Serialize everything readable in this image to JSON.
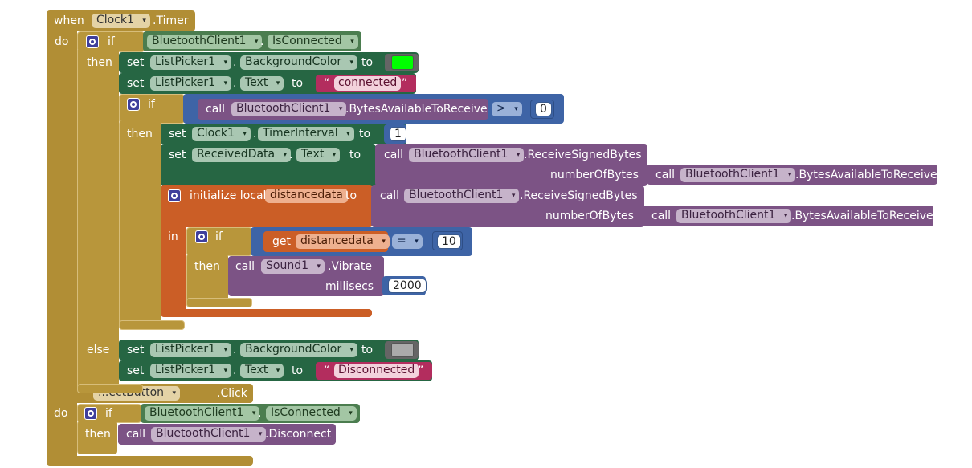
{
  "workspace": {
    "event1": {
      "when": "when",
      "component": "Clock1",
      "event": ".Timer",
      "do": "do",
      "if_label": "if",
      "then": "then",
      "else": "else",
      "cond_component": "BluetoothClient1",
      "cond_property": "IsConnected",
      "then_block": {
        "set1": {
          "set": "set",
          "component": "ListPicker1",
          "dot": ".",
          "property": "BackgroundColor",
          "to": "to",
          "color": "#00ff00"
        },
        "set2": {
          "set": "set",
          "component": "ListPicker1",
          "dot": ".",
          "property": "Text",
          "to": "to",
          "open_quote": "“",
          "value": "connected",
          "close_quote": "”"
        },
        "inner_if": {
          "if_label": "if",
          "call": "call",
          "component": "BluetoothClient1",
          "method": ".BytesAvailableToReceive",
          "operator": ">",
          "compare_value": "0",
          "then": "then",
          "set_interval": {
            "set": "set",
            "component": "Clock1",
            "dot": ".",
            "property": "TimerInterval",
            "to": "to",
            "value": "1"
          },
          "set_received": {
            "set": "set",
            "component": "ReceivedData",
            "dot": ".",
            "property": "Text",
            "to": "to",
            "call": "call",
            "call_component": "BluetoothClient1",
            "call_method": ".ReceiveSignedBytes",
            "param_label": "numberOfBytes",
            "param_call": "call",
            "param_component": "BluetoothClient1",
            "param_method": ".BytesAvailableToReceive"
          },
          "init_local": {
            "label": "initialize local",
            "var_name": "distancedata",
            "to": "to",
            "call": "call",
            "call_component": "BluetoothClient1",
            "call_method": ".ReceiveSignedBytes",
            "param_label": "numberOfBytes",
            "param_call": "call",
            "param_component": "BluetoothClient1",
            "param_method": ".BytesAvailableToReceive",
            "in": "in",
            "if_label": "if",
            "get": "get",
            "get_var": "distancedata",
            "operator": "=",
            "compare_value": "10",
            "then": "then",
            "vib_call": "call",
            "vib_component": "Sound1",
            "vib_method": ".Vibrate",
            "vib_param": "millisecs",
            "vib_value": "2000"
          }
        }
      },
      "else_block": {
        "set1": {
          "set": "set",
          "component": "ListPicker1",
          "dot": ".",
          "property": "BackgroundColor",
          "to": "to",
          "color": "#aaaaaa"
        },
        "set2": {
          "set": "set",
          "component": "ListPicker1",
          "dot": ".",
          "property": "Text",
          "to": "to",
          "open_quote": "“",
          "value": "Disconnected",
          "close_quote": "”"
        }
      }
    },
    "event2": {
      "component_partial": "...ectButton",
      "event": ".Click",
      "do": "do",
      "if_label": "if",
      "cond_component": "BluetoothClient1",
      "cond_property": "IsConnected",
      "then": "then",
      "call": "call",
      "call_component": "BluetoothClient1",
      "call_method": ".Disconnect"
    }
  },
  "dropdown_arrow": "▾",
  "colors": {
    "event": "#b18e35",
    "control": "#b8963b",
    "setter": "#266643",
    "bluetooth_getter": "#4b7d4f",
    "procedure_call": "#7c5385",
    "math": "#3e64a6",
    "variable": "#cb5e26",
    "text": "#b32d5e",
    "color": "#656565"
  }
}
